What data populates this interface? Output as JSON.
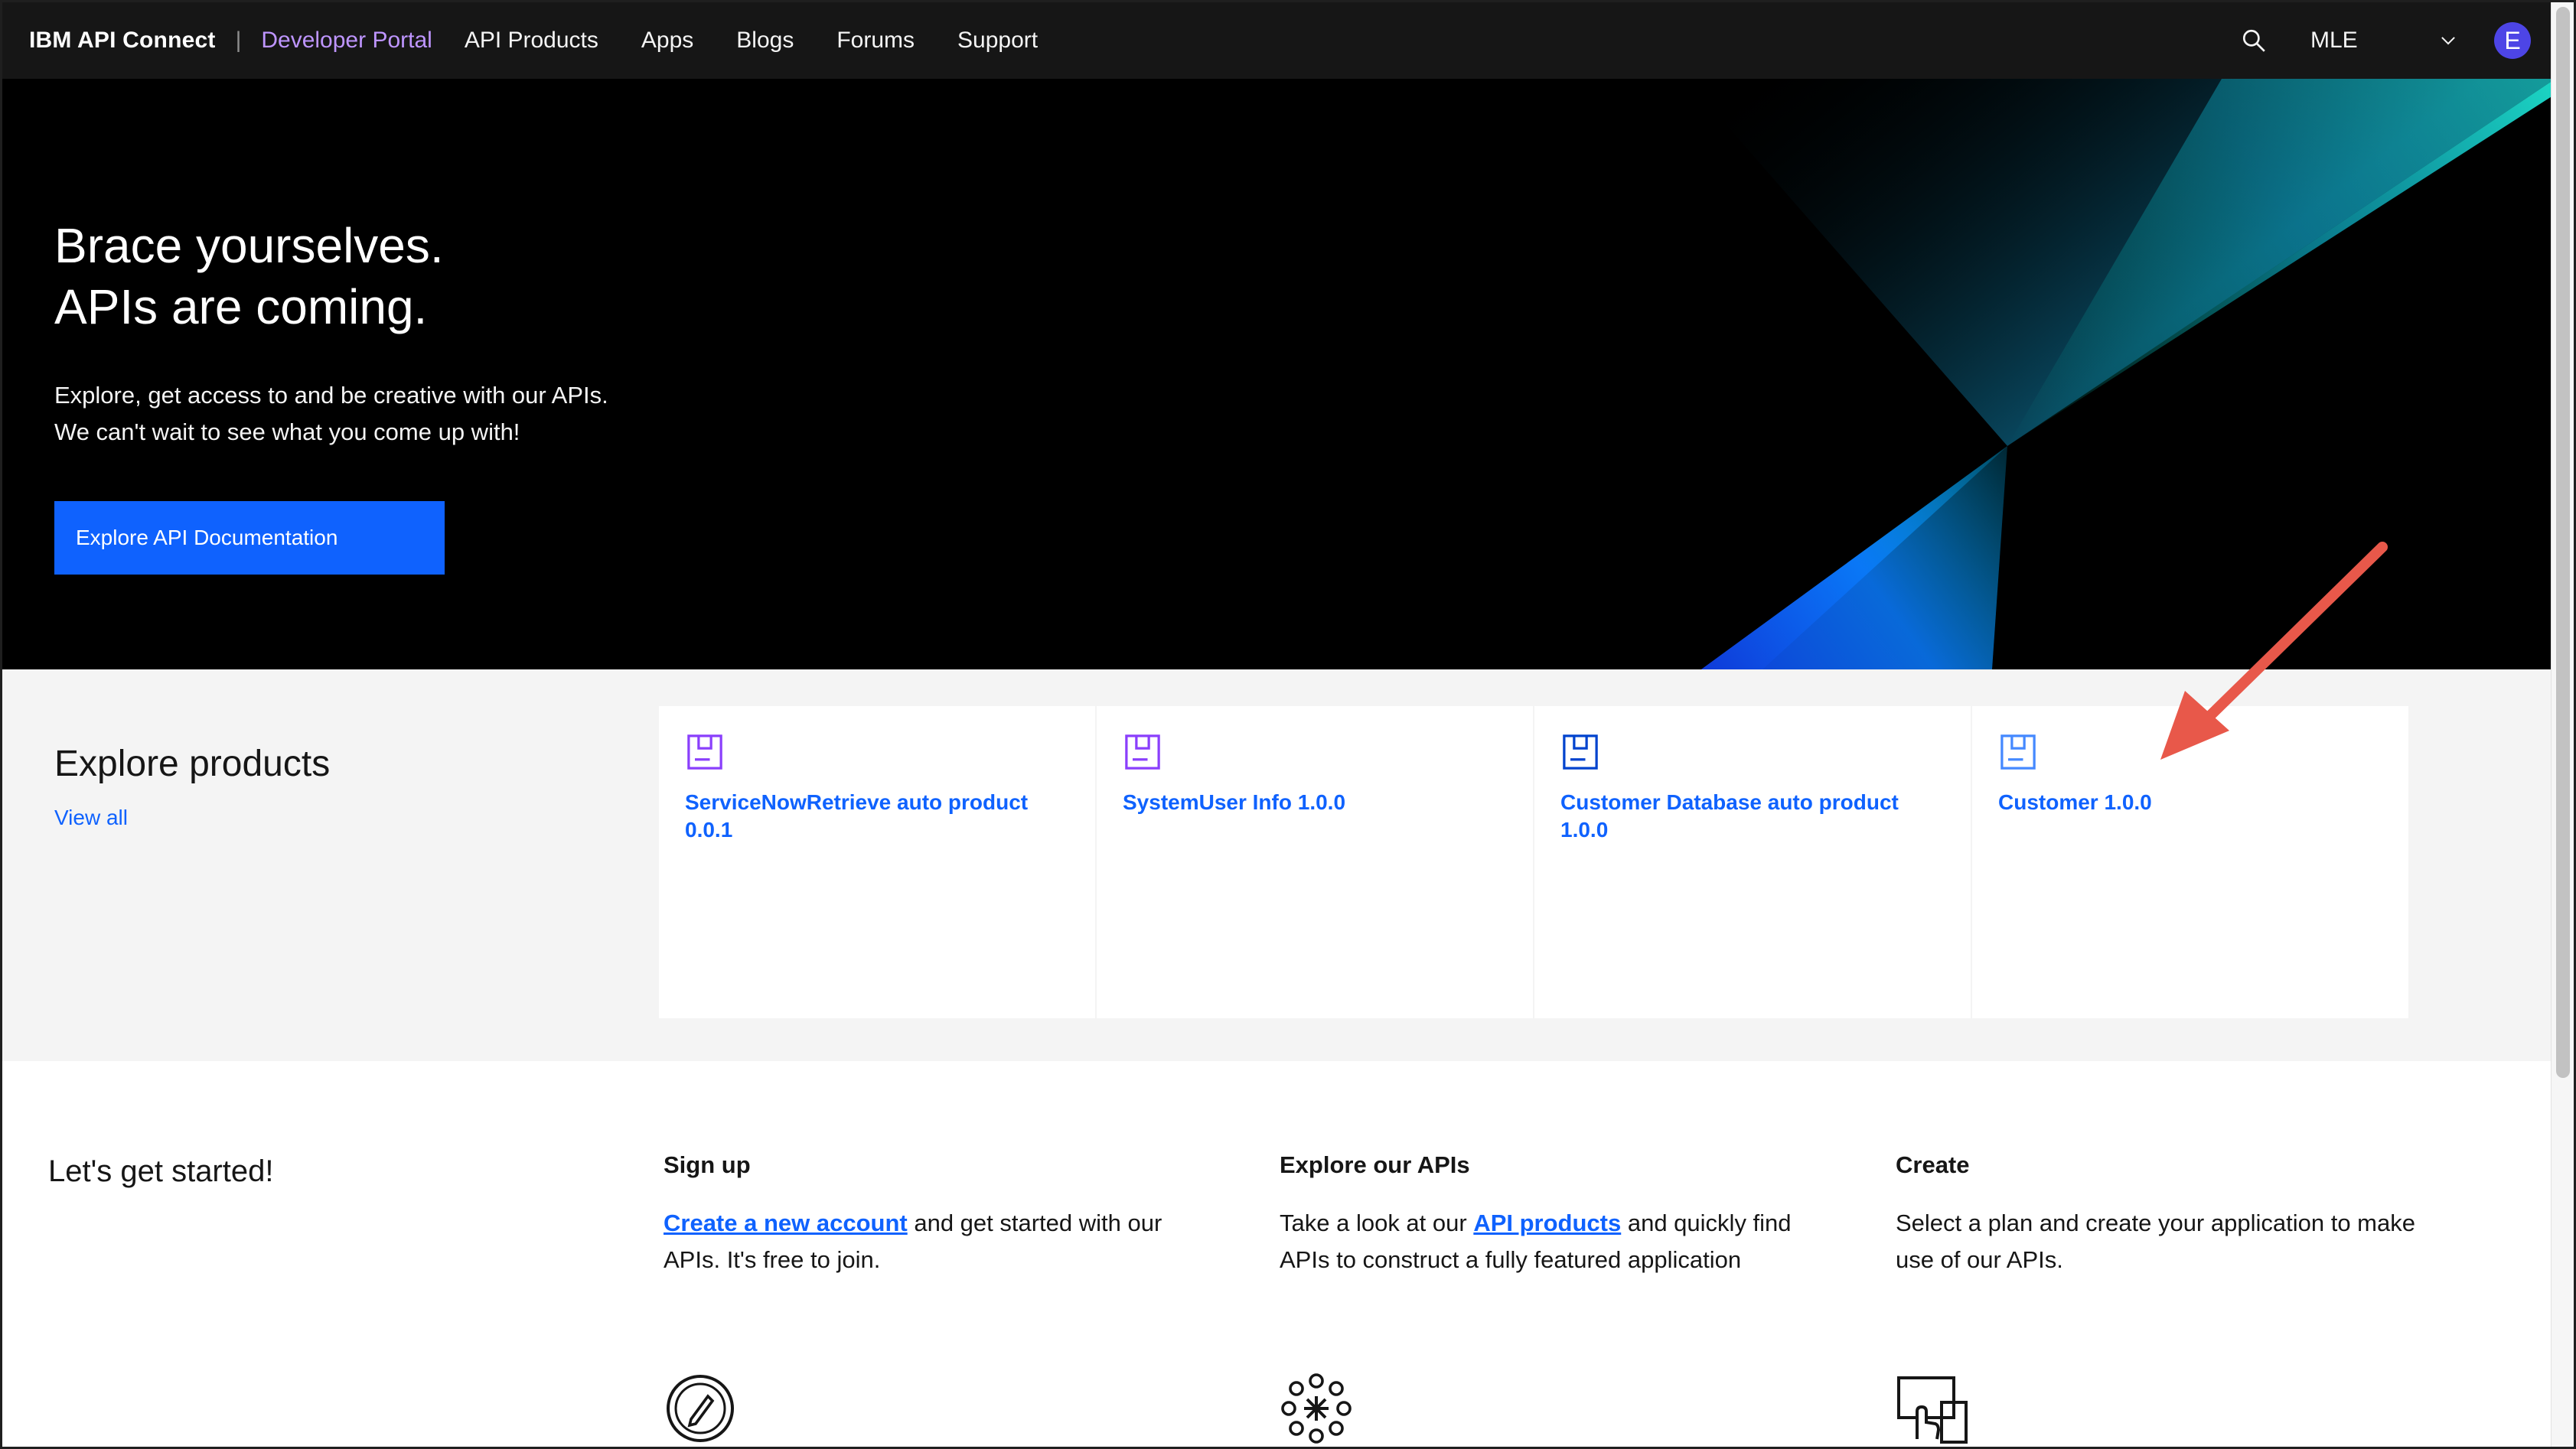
{
  "topnav": {
    "brand": "IBM API Connect",
    "separator": "|",
    "portal_name": "Developer Portal",
    "links": [
      "API Products",
      "Apps",
      "Blogs",
      "Forums",
      "Support"
    ],
    "org_name": "MLE",
    "avatar_initial": "E",
    "icons": {
      "search": "search-icon",
      "org_menu": "chevron-down-icon"
    }
  },
  "hero": {
    "title_line1": "Brace yourselves.",
    "title_line2": "APIs are coming.",
    "desc_line1": "Explore, get access to and be creative with our APIs.",
    "desc_line2": "We can't wait to see what you come up with!",
    "button_label": "Explore API Documentation"
  },
  "products": {
    "title": "Explore products",
    "view_all": "View all",
    "cards": [
      {
        "title": "ServiceNowRetrieve auto product 0.0.1",
        "icon_color": "#8a3ffc"
      },
      {
        "title": "SystemUser Info 1.0.0",
        "icon_color": "#8a3ffc"
      },
      {
        "title": "Customer Database auto product 1.0.0",
        "icon_color": "#0043ce"
      },
      {
        "title": "Customer 1.0.0",
        "icon_color": "#4589ff"
      }
    ]
  },
  "started": {
    "title": "Let's get started!",
    "signup": {
      "title": "Sign up",
      "link": "Create a new account",
      "text_after": " and get started with our APIs. It's free to join."
    },
    "explore": {
      "title": "Explore our APIs",
      "text_before": "Take a look at our ",
      "link": "API products",
      "text_after": " and quickly find APIs to construct a fully featured application"
    },
    "create": {
      "title": "Create",
      "text": "Select a plan and create your application to make use of our APIs."
    }
  },
  "colors": {
    "nav_bg": "#161616",
    "accent_blue": "#0f62fe",
    "portal_purple": "#be95ff",
    "annotation_arrow": "#e8584a"
  }
}
